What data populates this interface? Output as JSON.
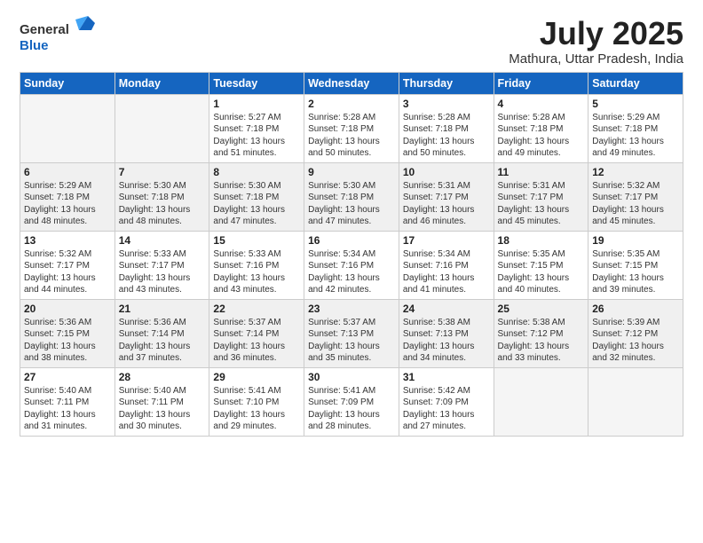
{
  "logo": {
    "general": "General",
    "blue": "Blue"
  },
  "title": "July 2025",
  "subtitle": "Mathura, Uttar Pradesh, India",
  "weekdays": [
    "Sunday",
    "Monday",
    "Tuesday",
    "Wednesday",
    "Thursday",
    "Friday",
    "Saturday"
  ],
  "weeks": [
    [
      {
        "day": "",
        "info": ""
      },
      {
        "day": "",
        "info": ""
      },
      {
        "day": "1",
        "info": "Sunrise: 5:27 AM\nSunset: 7:18 PM\nDaylight: 13 hours and 51 minutes."
      },
      {
        "day": "2",
        "info": "Sunrise: 5:28 AM\nSunset: 7:18 PM\nDaylight: 13 hours and 50 minutes."
      },
      {
        "day": "3",
        "info": "Sunrise: 5:28 AM\nSunset: 7:18 PM\nDaylight: 13 hours and 50 minutes."
      },
      {
        "day": "4",
        "info": "Sunrise: 5:28 AM\nSunset: 7:18 PM\nDaylight: 13 hours and 49 minutes."
      },
      {
        "day": "5",
        "info": "Sunrise: 5:29 AM\nSunset: 7:18 PM\nDaylight: 13 hours and 49 minutes."
      }
    ],
    [
      {
        "day": "6",
        "info": "Sunrise: 5:29 AM\nSunset: 7:18 PM\nDaylight: 13 hours and 48 minutes."
      },
      {
        "day": "7",
        "info": "Sunrise: 5:30 AM\nSunset: 7:18 PM\nDaylight: 13 hours and 48 minutes."
      },
      {
        "day": "8",
        "info": "Sunrise: 5:30 AM\nSunset: 7:18 PM\nDaylight: 13 hours and 47 minutes."
      },
      {
        "day": "9",
        "info": "Sunrise: 5:30 AM\nSunset: 7:18 PM\nDaylight: 13 hours and 47 minutes."
      },
      {
        "day": "10",
        "info": "Sunrise: 5:31 AM\nSunset: 7:17 PM\nDaylight: 13 hours and 46 minutes."
      },
      {
        "day": "11",
        "info": "Sunrise: 5:31 AM\nSunset: 7:17 PM\nDaylight: 13 hours and 45 minutes."
      },
      {
        "day": "12",
        "info": "Sunrise: 5:32 AM\nSunset: 7:17 PM\nDaylight: 13 hours and 45 minutes."
      }
    ],
    [
      {
        "day": "13",
        "info": "Sunrise: 5:32 AM\nSunset: 7:17 PM\nDaylight: 13 hours and 44 minutes."
      },
      {
        "day": "14",
        "info": "Sunrise: 5:33 AM\nSunset: 7:17 PM\nDaylight: 13 hours and 43 minutes."
      },
      {
        "day": "15",
        "info": "Sunrise: 5:33 AM\nSunset: 7:16 PM\nDaylight: 13 hours and 43 minutes."
      },
      {
        "day": "16",
        "info": "Sunrise: 5:34 AM\nSunset: 7:16 PM\nDaylight: 13 hours and 42 minutes."
      },
      {
        "day": "17",
        "info": "Sunrise: 5:34 AM\nSunset: 7:16 PM\nDaylight: 13 hours and 41 minutes."
      },
      {
        "day": "18",
        "info": "Sunrise: 5:35 AM\nSunset: 7:15 PM\nDaylight: 13 hours and 40 minutes."
      },
      {
        "day": "19",
        "info": "Sunrise: 5:35 AM\nSunset: 7:15 PM\nDaylight: 13 hours and 39 minutes."
      }
    ],
    [
      {
        "day": "20",
        "info": "Sunrise: 5:36 AM\nSunset: 7:15 PM\nDaylight: 13 hours and 38 minutes."
      },
      {
        "day": "21",
        "info": "Sunrise: 5:36 AM\nSunset: 7:14 PM\nDaylight: 13 hours and 37 minutes."
      },
      {
        "day": "22",
        "info": "Sunrise: 5:37 AM\nSunset: 7:14 PM\nDaylight: 13 hours and 36 minutes."
      },
      {
        "day": "23",
        "info": "Sunrise: 5:37 AM\nSunset: 7:13 PM\nDaylight: 13 hours and 35 minutes."
      },
      {
        "day": "24",
        "info": "Sunrise: 5:38 AM\nSunset: 7:13 PM\nDaylight: 13 hours and 34 minutes."
      },
      {
        "day": "25",
        "info": "Sunrise: 5:38 AM\nSunset: 7:12 PM\nDaylight: 13 hours and 33 minutes."
      },
      {
        "day": "26",
        "info": "Sunrise: 5:39 AM\nSunset: 7:12 PM\nDaylight: 13 hours and 32 minutes."
      }
    ],
    [
      {
        "day": "27",
        "info": "Sunrise: 5:40 AM\nSunset: 7:11 PM\nDaylight: 13 hours and 31 minutes."
      },
      {
        "day": "28",
        "info": "Sunrise: 5:40 AM\nSunset: 7:11 PM\nDaylight: 13 hours and 30 minutes."
      },
      {
        "day": "29",
        "info": "Sunrise: 5:41 AM\nSunset: 7:10 PM\nDaylight: 13 hours and 29 minutes."
      },
      {
        "day": "30",
        "info": "Sunrise: 5:41 AM\nSunset: 7:09 PM\nDaylight: 13 hours and 28 minutes."
      },
      {
        "day": "31",
        "info": "Sunrise: 5:42 AM\nSunset: 7:09 PM\nDaylight: 13 hours and 27 minutes."
      },
      {
        "day": "",
        "info": ""
      },
      {
        "day": "",
        "info": ""
      }
    ]
  ],
  "shaded_rows": [
    1,
    3
  ]
}
